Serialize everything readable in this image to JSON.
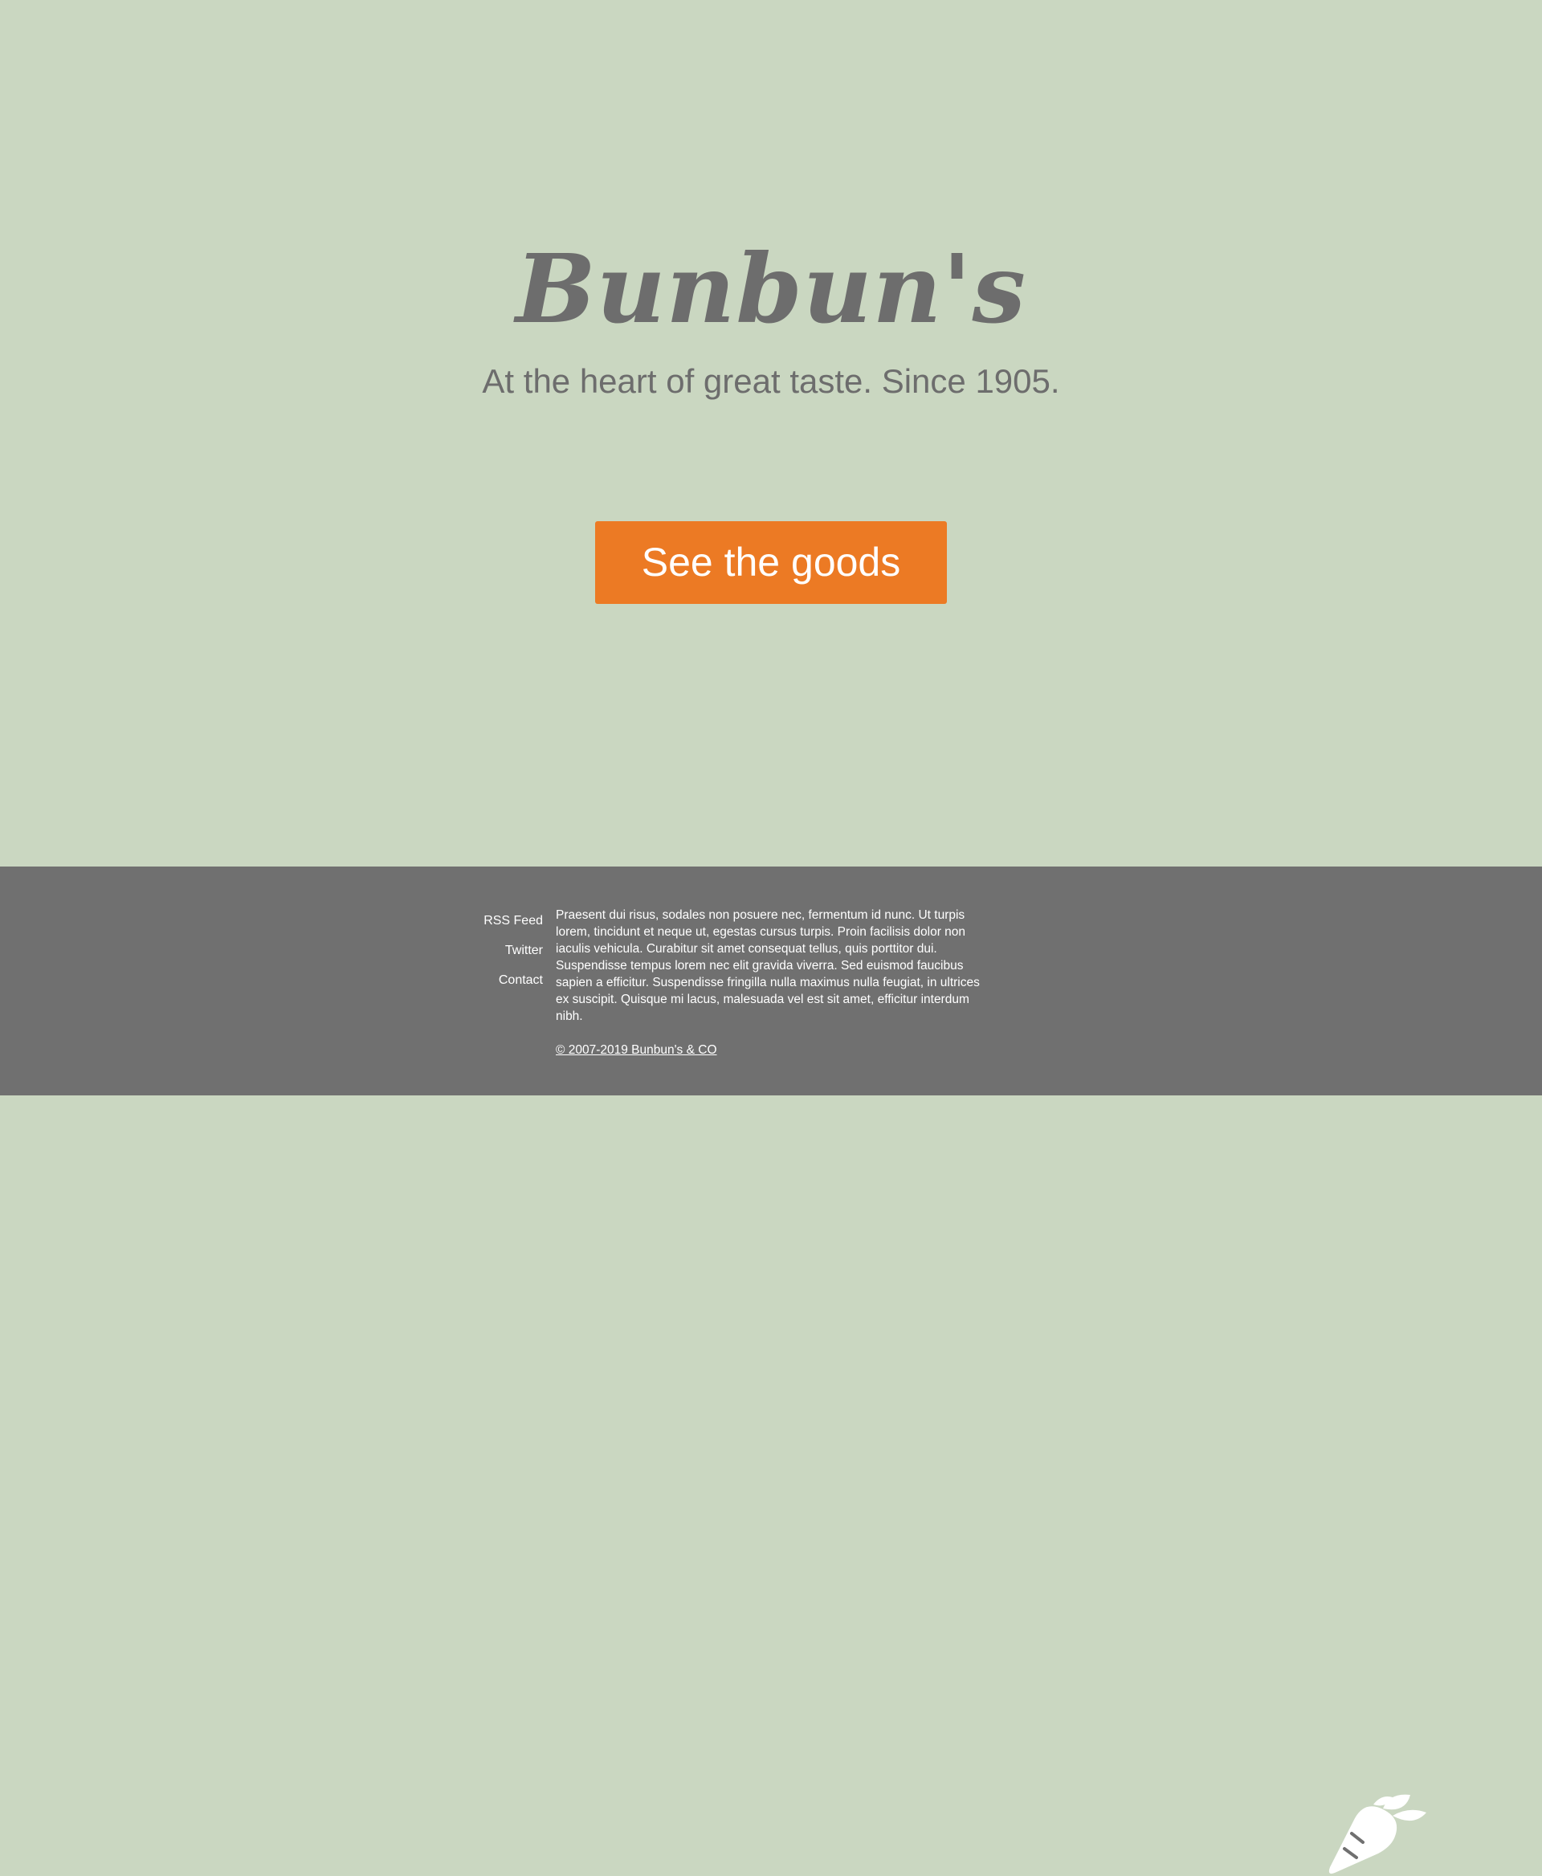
{
  "hero": {
    "brand": "Bunbun's",
    "tagline": "At the heart of great taste. Since 1905.",
    "cta_label": "See the goods"
  },
  "footer": {
    "links": [
      "RSS Feed",
      "Twitter",
      "Contact"
    ],
    "body": "Praesent dui risus, sodales non posuere nec, fermentum id nunc. Ut turpis lorem, tincidunt et neque ut, egestas cursus turpis. Proin facilisis dolor non iaculis vehicula. Curabitur sit amet consequat tellus, quis porttitor dui. Suspendisse tempus lorem nec elit gravida viverra. Sed euismod faucibus sapien a efficitur. Suspendisse fringilla nulla maximus nulla feugiat, in ultrices ex suscipit. Quisque mi lacus, malesuada vel est sit amet, efficitur interdum nibh.",
    "copyright": "© 2007-2019 Bunbun's & CO",
    "logo_icon": "carrot-icon"
  },
  "colors": {
    "background": "#cad7c1",
    "text": "#6d6d6d",
    "accent": "#ec7a24",
    "footer": "#707070"
  }
}
